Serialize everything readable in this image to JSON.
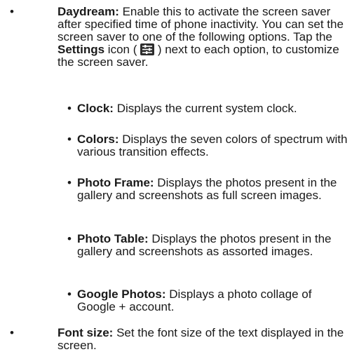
{
  "bullet_symbol": "•",
  "items": [
    {
      "title": "Daydream:",
      "text_before_icon": " Enable this to activate the screen saver after specified time of phone inactivity. You can set the screen saver to one of the following options. Tap the ",
      "settings_word": "Settings",
      "text_icon_lead": " icon ( ",
      "icon": "settings-sliders-icon",
      "text_after_icon": " ) next to each option, to customize the screen saver."
    },
    {
      "title": "Font size:",
      "text": " Set the font size of the text displayed in the screen."
    }
  ],
  "subitems": [
    {
      "title": "Clock:",
      "text": " Displays the current system clock."
    },
    {
      "title": "Colors:",
      "text": " Displays the seven colors of spectrum with various transition effects."
    },
    {
      "title": "Photo Frame:",
      "text": " Displays the photos present in the gallery and screenshots as full screen images."
    },
    {
      "title": "Photo Table:",
      "text": " Displays the photos present in the gallery and screenshots as assorted images."
    },
    {
      "title": "Google Photos:",
      "text": " Displays a photo collage of Google + account."
    }
  ],
  "colors": {
    "text": "#1a1a1a",
    "icon_background": "#2d2d2d",
    "icon_foreground": "#ffffff"
  }
}
